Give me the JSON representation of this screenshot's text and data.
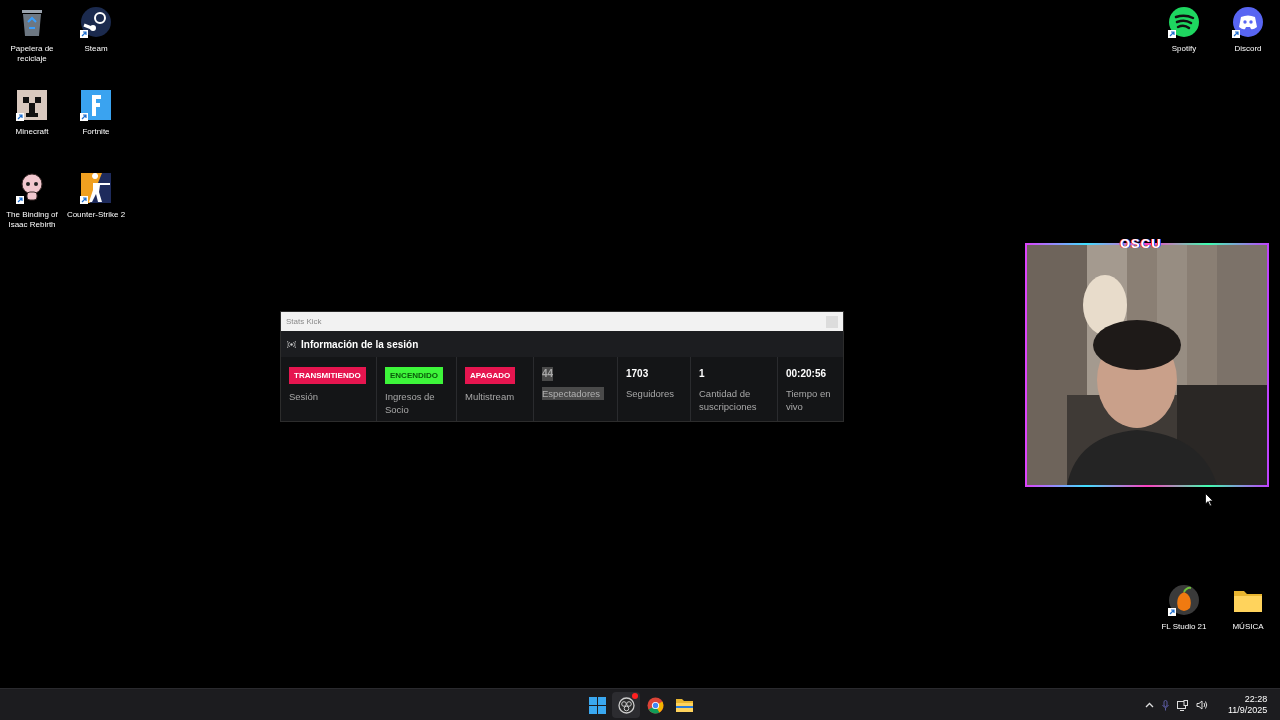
{
  "desktop": {
    "left_icons": [
      {
        "label": "Papelera de reciclaje",
        "kind": "bin",
        "shortcut": false
      },
      {
        "label": "Steam",
        "kind": "steam",
        "shortcut": true
      },
      {
        "label": "Minecraft",
        "kind": "block",
        "shortcut": true
      },
      {
        "label": "Fortnite",
        "kind": "letter",
        "shortcut": true
      },
      {
        "label": "The Binding of Isaac Rebirth",
        "kind": "baby",
        "shortcut": true
      },
      {
        "label": "Counter-Strike 2",
        "kind": "soldier",
        "shortcut": true
      }
    ],
    "right_top_icons": [
      {
        "label": "Spotify",
        "kind": "waves",
        "shortcut": true
      },
      {
        "label": "Discord",
        "kind": "controller",
        "shortcut": true
      }
    ],
    "right_bottom_icons": [
      {
        "label": "FL Studio 21",
        "kind": "fruit",
        "shortcut": true
      },
      {
        "label": "MÚSICA",
        "kind": "folder",
        "shortcut": false
      }
    ]
  },
  "stats_window": {
    "title": "Stats Kick",
    "heading": "Información de la sesión",
    "cells": [
      {
        "kind": "badge",
        "value": "TRANSMITIENDO",
        "color": "#e6154f",
        "label": "Sesión",
        "highlighted": false
      },
      {
        "kind": "badge",
        "value": "ENCENDIDO",
        "color": "#3df53a",
        "label": "Ingresos de Socio",
        "highlighted": false
      },
      {
        "kind": "badge",
        "value": "APAGADO",
        "color": "#e6154f",
        "label": "Multistream",
        "highlighted": false
      },
      {
        "kind": "number",
        "value": "44",
        "label": "Espectadores",
        "highlighted": true
      },
      {
        "kind": "number",
        "value": "1703",
        "label": "Seguidores",
        "highlighted": false
      },
      {
        "kind": "number",
        "value": "1",
        "label": "Cantidad de suscripciones",
        "highlighted": false
      },
      {
        "kind": "number",
        "value": "00:20:56",
        "label": "Tiempo en vivo",
        "highlighted": false
      }
    ]
  },
  "webcam": {
    "overlay": "OSCU"
  },
  "taskbar": {
    "apps": [
      {
        "kind": "start",
        "notification": false
      },
      {
        "kind": "recorder",
        "notification": true
      },
      {
        "kind": "browser",
        "notification": false
      },
      {
        "kind": "files",
        "notification": false
      }
    ],
    "time": "22:28",
    "date": "11/9/2025"
  }
}
